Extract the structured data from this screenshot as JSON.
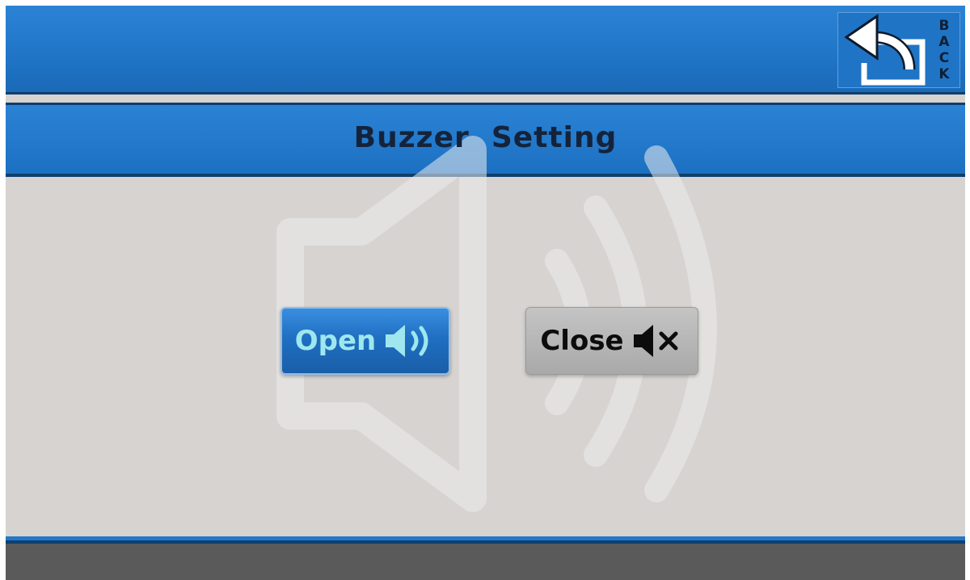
{
  "header": {
    "back_label": "BACK",
    "back_letters": [
      "B",
      "A",
      "C",
      "K"
    ]
  },
  "title": "Buzzer  Setting",
  "buttons": {
    "open_label": "Open",
    "close_label": "Close"
  },
  "icons": {
    "back": "return-arrow-icon",
    "open": "speaker-sound-icon",
    "close": "speaker-mute-icon",
    "background": "speaker-watermark-icon"
  },
  "colors": {
    "header_blue": "#1f74c6",
    "dark_blue": "#0f3f6e",
    "body_gray": "#d6d3d1",
    "title_text": "#15233a",
    "open_text": "#9fe7ef",
    "footer_gray": "#5a5a5a"
  }
}
